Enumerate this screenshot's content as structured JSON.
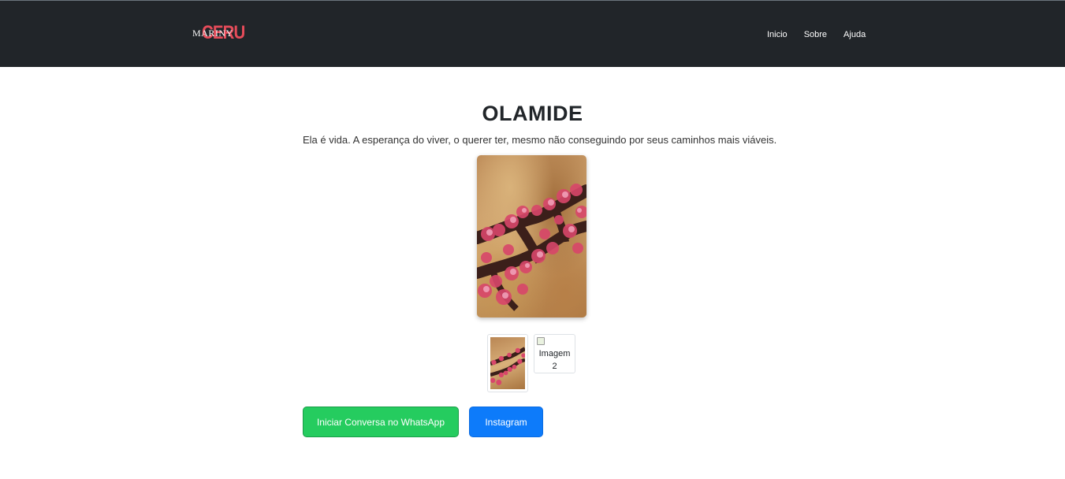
{
  "nav": {
    "logo_back": "CERU",
    "logo_front": "MARINY",
    "links": [
      "Inicio",
      "Sobre",
      "Ajuda"
    ]
  },
  "product": {
    "title": "OLAMIDE",
    "description": "Ela é vida. A esperança do viver, o querer ter, mesmo não conseguindo por seus caminhos mais viáveis.",
    "thumb2_alt": "Imagem 2"
  },
  "actions": {
    "whatsapp_label": "Iniciar Conversa no WhatsApp",
    "instagram_label": "Instagram"
  },
  "colors": {
    "navbar": "#212529",
    "whatsapp": "#25cc5f",
    "instagram": "#0d7bfa",
    "logo_accent": "#e74c5a"
  }
}
